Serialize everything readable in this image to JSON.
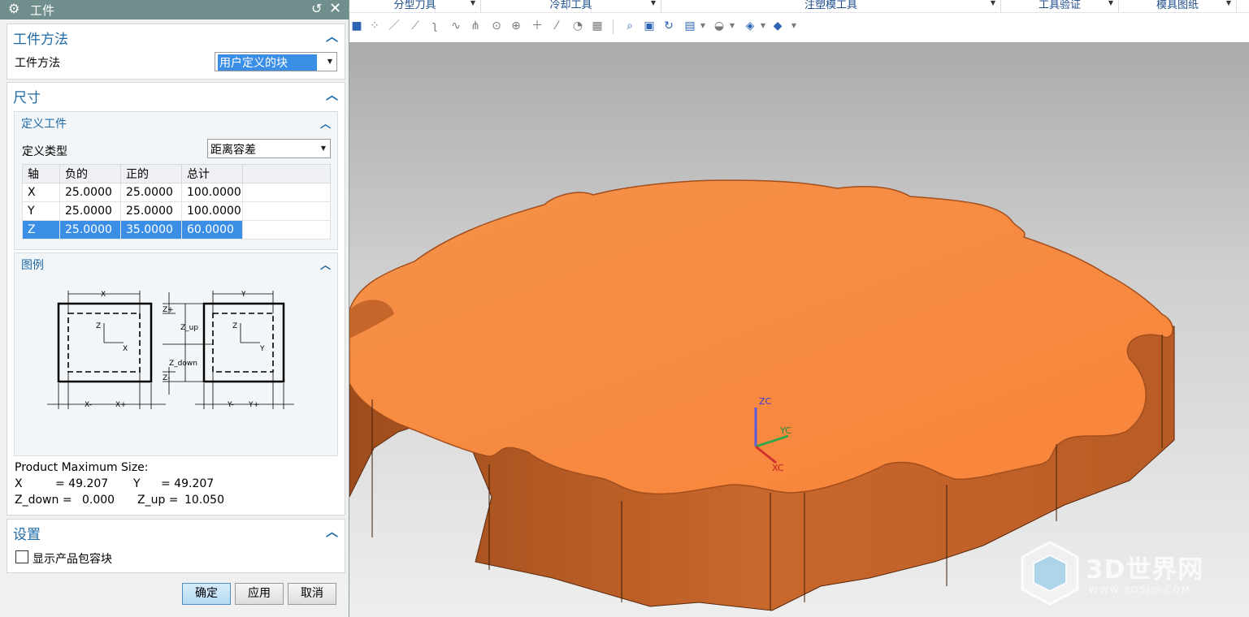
{
  "ribbon": {
    "groups": [
      "分型刀具",
      "冷却工具",
      "注塑模工具",
      "工具验证",
      "模具图纸"
    ]
  },
  "dialog": {
    "title": "工件",
    "method_section": {
      "header": "工件方法",
      "label": "工件方法",
      "selected": "用户定义的块"
    },
    "size_section": {
      "header": "尺寸",
      "define": {
        "header": "定义工件",
        "type_label": "定义类型",
        "type_value": "距离容差",
        "columns": [
          "轴",
          "负的",
          "正的",
          "总计"
        ],
        "rows": [
          [
            "X",
            "25.0000",
            "25.0000",
            "100.0000"
          ],
          [
            "Y",
            "25.0000",
            "25.0000",
            "100.0000"
          ],
          [
            "Z",
            "25.0000",
            "35.0000",
            "60.0000"
          ]
        ],
        "selected_row": 2
      },
      "legend": {
        "header": "图例",
        "labels": {
          "x": "X",
          "y": "Y",
          "z": "Z",
          "z_plus": "Z+",
          "z_minus": "Z-",
          "z_up": "Z_up",
          "z_down": "Z_down",
          "x_minus": "X-",
          "x_plus": "X+",
          "y_minus": "Y-",
          "y_plus": "Y+"
        }
      },
      "product_size": {
        "title": "Product Maximum Size:",
        "x_label": "X",
        "x_value": "= 49.207",
        "y_label": "Y",
        "y_value": "= 49.207",
        "zdown_label": "Z_down =",
        "zdown_value": "0.000",
        "zup_label": "Z_up =",
        "zup_value": "10.050"
      }
    },
    "settings_section": {
      "header": "设置",
      "checkbox_label": "显示产品包容块",
      "checkbox_checked": false
    },
    "buttons": {
      "ok": "确定",
      "apply": "应用",
      "cancel": "取消"
    }
  },
  "viewport": {
    "axes": {
      "z": "ZC",
      "y": "YC",
      "x": "XC"
    },
    "colors": {
      "part": "#f48a40",
      "part_side": "#c86a30"
    }
  },
  "watermark": {
    "text": "3D世界网",
    "sub": "WWW.3DSJW.COM"
  }
}
